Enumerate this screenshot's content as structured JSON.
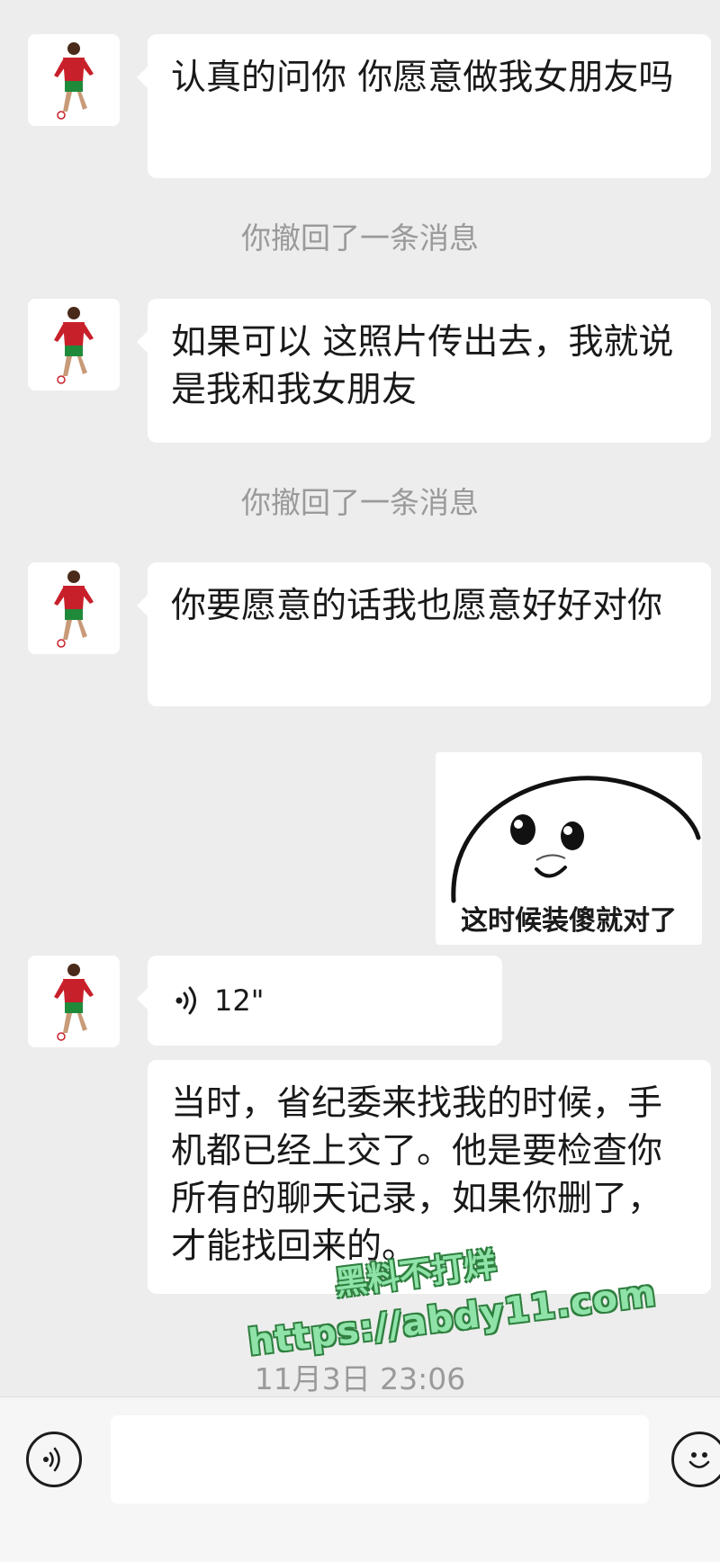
{
  "messages": [
    {
      "type": "text",
      "text": "认真的问你 你愿意做我女朋友吗"
    },
    {
      "type": "system",
      "text": "你撤回了一条消息"
    },
    {
      "type": "text",
      "text": "如果可以 这照片传出去，我就说是我和我女朋友"
    },
    {
      "type": "system",
      "text": "你撤回了一条消息"
    },
    {
      "type": "text",
      "text": "你要愿意的话我也愿意好好对你"
    },
    {
      "type": "sticker",
      "caption": "这时候装傻就对了"
    },
    {
      "type": "voice",
      "duration": "12\""
    },
    {
      "type": "text",
      "text": "当时，省纪委来找我的时候，手机都已经上交了。他是要检查你所有的聊天记录，如果你删了，才能找回来的。"
    },
    {
      "type": "timestamp",
      "text": "11月3日 23:06"
    }
  ],
  "watermark": {
    "line1": "黑料不打烊",
    "line2": "https://abdy11.com"
  },
  "input_bar": {
    "voice_icon": "voice-icon",
    "emoji_icon": "emoji-icon"
  },
  "colors": {
    "background": "#ededed",
    "bubble": "#ffffff",
    "system_text": "#9a9a9a",
    "watermark": "#8fe3a9"
  }
}
